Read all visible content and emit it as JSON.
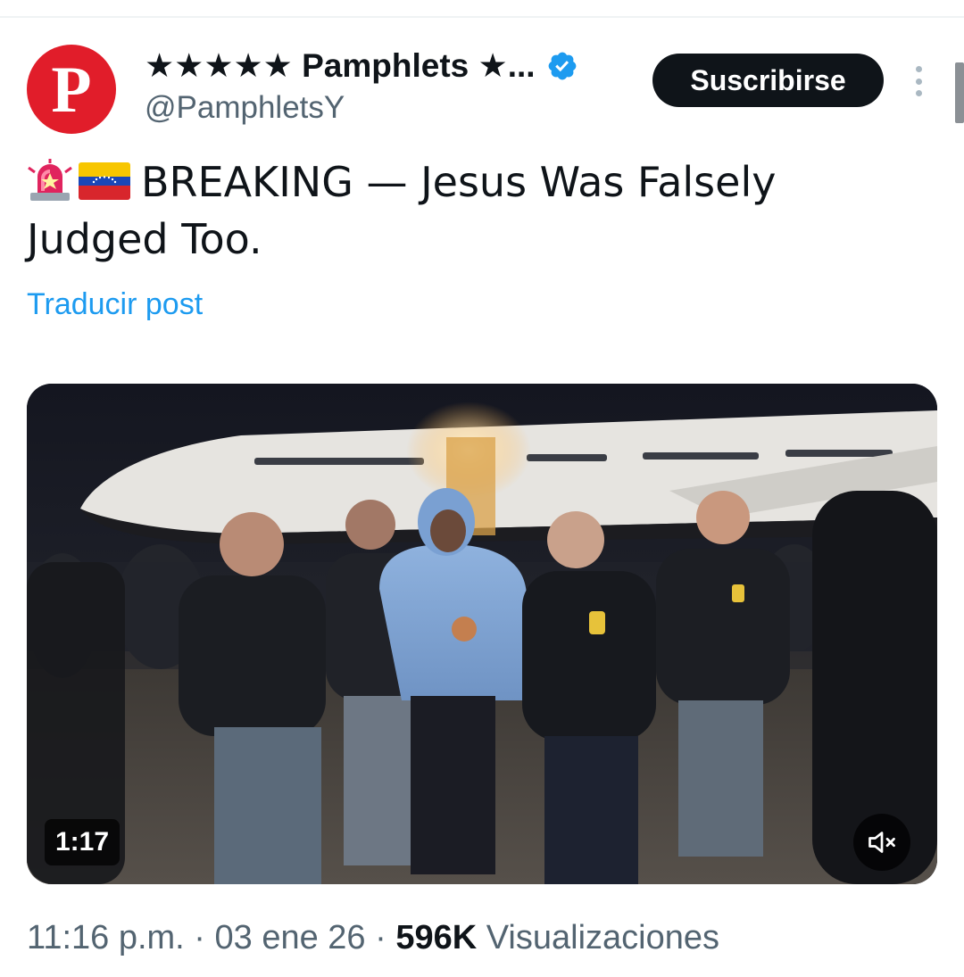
{
  "author": {
    "avatar_letter": "P",
    "display_name": "★★★★★ Pamphlets ★...",
    "handle": "@PamphletsY",
    "verified": true
  },
  "actions": {
    "subscribe_label": "Suscribirse"
  },
  "tweet": {
    "emojis": [
      "siren-emoji",
      "venezuela-flag-emoji"
    ],
    "text": "BREAKING — Jesus Was Falsely Judged Too.",
    "translate_label": "Traducir post"
  },
  "video": {
    "duration": "1:17",
    "muted": true
  },
  "meta": {
    "time": "11:16 p.m.",
    "separator": "·",
    "date": "03 ene 26",
    "views_count": "596K",
    "views_label": "Visualizaciones"
  },
  "colors": {
    "avatar_bg": "#e11d2a",
    "link": "#1d9bf0",
    "verified": "#1d9bf0",
    "button_bg": "#0f1419",
    "secondary_text": "#536471"
  }
}
